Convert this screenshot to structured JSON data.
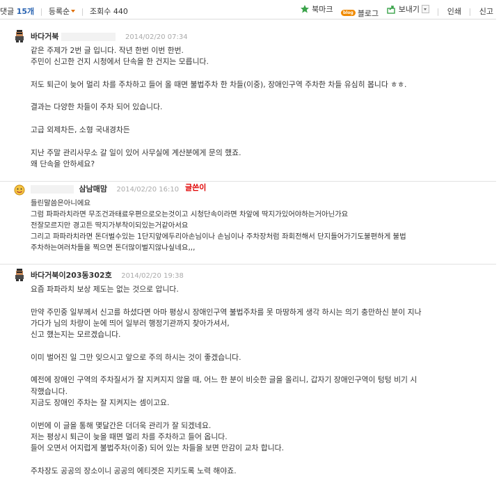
{
  "topbar": {
    "comments_label": "댓글",
    "comments_count": "15개",
    "sort_label": "등록순",
    "views_label": "조회수",
    "views_count": "440",
    "bookmark": "북마크",
    "blog_badge": "blog",
    "blog": "블로그",
    "send": "보내기",
    "print": "인쇄",
    "report": "신고"
  },
  "comments": [
    {
      "nick": "바다거북",
      "date": "2014/02/20 07:34",
      "lines": [
        "같은 주제가 2번 글 입니다. 작년 한번 이번 한번.",
        "주민이 신고한 건지 시청에서 단속을 한 건지는 모릅니다.",
        "",
        "저도 퇴근이 늦어 멀리 차를 주차하고 들어 올 때면 불법주차 한 차들(이중), 장애인구역 주차한 차들 유심히 봅니다 ㅎㅎ.",
        "",
        "결과는 다양한 차들이 주차 되어 있습니다.",
        "",
        "고급 외제차든, 소형 국내경차든",
        "",
        "지난 주말 관리사무소 갈 일이 있어 사무실에 계산분에게 문의 했죠.",
        "왜 단속을 안하세요?"
      ]
    },
    {
      "nick": "삼남매맘",
      "date": "2014/02/20 16:10",
      "writer_tag": "글쓴이",
      "lines": [
        "들린말씀은아니에요",
        "그럼 파파라치라면 무조건과태료우편으로오는것이고 시청단속이라면 차앞에 딱지가있어야하는거아닌가요",
        "전잘모르지만 경고든 딱지가부착이되있는거같아서요",
        "그리고 파파라치라면 돈더벌수있는 1단지앞에두리아손님이나 손님이나 주차장처럼 좌회전해서 단지들어가기도불편하게 불법",
        "주차하는여러차들을 찍으면 돈더많이벌지않나싶네요,,,"
      ]
    },
    {
      "nick": "바다거북이203동302호",
      "date": "2014/02/20 19:38",
      "lines": [
        "요즘 파파라치 보상 제도는 없는 것으로 압니다.",
        "",
        "만약 주민중 일부께서 신고를 하셨다면 아마 평상시 장애인구역 불법주차를 못 마땅하게 생각 하시는 의기 충만하신 분이 지나",
        "가다가 님의 차량이 눈에 띄어 일부러 행정기관까지 찾아가셔서,",
        "신고 했는지는 모르겠습니다.",
        "",
        "이미 벌어진 일 그만 잊으시고 앞으로 주의 하시는 것이 좋겠습니다.",
        "",
        "예전에 장애인 구역의 주차질서가 잘 지켜지지 않을 때, 어느 한 분이 비슷한 글을 올리니, 갑자기 장애인구역이 텅텅 비기 시",
        "작했습니다.",
        "지금도 장애인 주차는 잘 지켜지는 셈이고요.",
        "",
        "이번에 이 글을 통해 몇달간은 더더욱 관리가 잘 되겠네요.",
        "저는 평상시 퇴근이 늦을 때면 멀리 차를 주차하고 들어 옵니다.",
        "들어 오면서 어지럽게 불법주차(이중) 되어 있는 차들을 보면 만감이 교차 합니다.",
        "",
        "주차장도 공공의 장소이니 공공의 에티겟은 지키도록 노력 해야죠."
      ]
    }
  ]
}
